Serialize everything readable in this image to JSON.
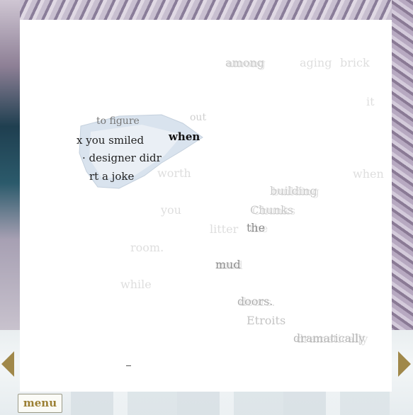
{
  "words": {
    "among": "among",
    "aging": "aging",
    "brick": "brick",
    "it": "it",
    "worth": "worth",
    "when_right": "when",
    "building": "building",
    "you": "you",
    "chunks": "Chunks",
    "litter": "litter",
    "the": "the",
    "room": "room.",
    "mud": "mud",
    "while": "while",
    "doors": "doors.",
    "etroits": "Etroits",
    "dramatically": "dramatically"
  },
  "scrap": {
    "line1": "to  figure",
    "line1b": "out",
    "line2": "x  you  smiled",
    "line2b": "when",
    "line3": "·  designer  didr",
    "line4": "rt  a  joke"
  },
  "nav": {
    "menu_label": "menu"
  }
}
